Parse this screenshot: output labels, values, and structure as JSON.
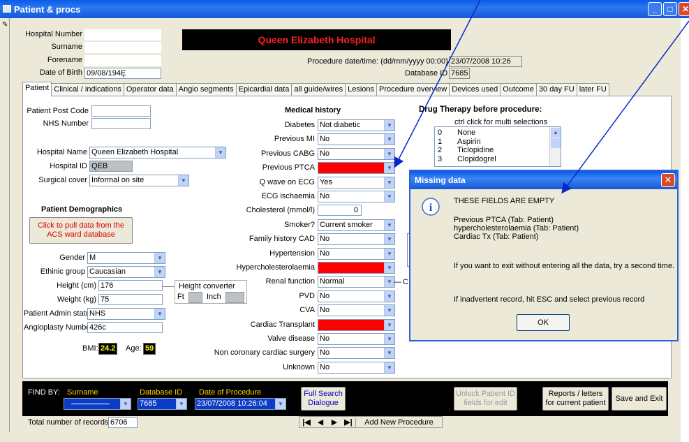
{
  "window": {
    "title": "Patient & procs"
  },
  "header": {
    "hospital_number_label": "Hospital Number",
    "surname_label": "Surname",
    "forename_label": "Forename",
    "dob_label": "Date of Birth",
    "dob_value": "09/08/194Ȩ",
    "hospital_banner": "Queen Elizabeth Hospital",
    "proc_date_label": "Procedure date/time: (dd/mm/yyyy 00:00)",
    "proc_date_value": "23/07/2008 10:26",
    "database_id_label": "Database ID",
    "database_id_value": "7685"
  },
  "tabs": [
    "Patient",
    "Clinical / indications",
    "Operator data",
    "Angio segments",
    "Epicardial data",
    "all guide/wires",
    "Lesions",
    "Procedure overview",
    "Devices used",
    "Outcome",
    "30 day FU",
    "later FU"
  ],
  "patient": {
    "post_code_label": "Patient Post Code",
    "nhs_label": "NHS Number",
    "hospital_name_label": "Hospital Name",
    "hospital_name_value": "Queen Elizabeth Hospital",
    "hospital_id_label": "Hospital ID",
    "hospital_id_value": "QEB",
    "surgical_cover_label": "Surgical cover",
    "surgical_cover_value": "Informal on site",
    "demographics_title": "Patient Demographics",
    "pull_button": "Click to pull data from the ACS ward database",
    "gender_label": "Gender",
    "gender_value": "M",
    "ethnic_label": "Ethinic group",
    "ethnic_value": "Caucasian",
    "height_label": "Height (cm)",
    "height_value": "176",
    "weight_label": "Weight (kg)",
    "weight_value": "75",
    "admin_label": "Patient Admin status",
    "admin_value": "NHS",
    "angio_label": "Angioplasty Number",
    "angio_value": "426c",
    "bmi_label": "BMI:",
    "bmi_value": "24.2",
    "age_label": "Age:",
    "age_value": "59",
    "height_conv_title": "Height converter",
    "ft_label": "Ft",
    "inch_label": "Inch"
  },
  "medical": {
    "title": "Medical history",
    "rows": [
      {
        "label": "Diabetes",
        "value": "Not diabetic",
        "red": false
      },
      {
        "label": "Previous MI",
        "value": "No",
        "red": false
      },
      {
        "label": "Previous CABG",
        "value": "No",
        "red": false
      },
      {
        "label": "Previous PTCA",
        "value": "",
        "red": true
      },
      {
        "label": "Q wave on ECG",
        "value": "Yes",
        "red": false
      },
      {
        "label": "ECG ischaemia",
        "value": "No",
        "red": false
      },
      {
        "label": "Cholesterol (mmol/l)",
        "value": "0",
        "red": false,
        "text": true
      },
      {
        "label": "Smoker?",
        "value": "Current smoker",
        "red": false
      },
      {
        "label": "Family history CAD",
        "value": "No",
        "red": false
      },
      {
        "label": "Hypertension",
        "value": "No",
        "red": false
      },
      {
        "label": "Hypercholesterolaemia",
        "value": "",
        "red": true
      },
      {
        "label": "Renal function",
        "value": "Normal",
        "red": false
      },
      {
        "label": "PVD",
        "value": "No",
        "red": false
      },
      {
        "label": "CVA",
        "value": "No",
        "red": false
      },
      {
        "label": "Cardiac Transplant",
        "value": "",
        "red": true
      },
      {
        "label": "Valve disease",
        "value": "No",
        "red": false
      },
      {
        "label": "Non coronary cardiac surgery",
        "value": "No",
        "red": false
      },
      {
        "label": "Unknown",
        "value": "No",
        "red": false
      }
    ]
  },
  "drug": {
    "title": "Drug Therapy before procedure:",
    "hint": "ctrl click for multi selections",
    "items": [
      {
        "n": "0",
        "name": "None"
      },
      {
        "n": "1",
        "name": "Aspirin"
      },
      {
        "n": "2",
        "name": "Ticlopidine"
      },
      {
        "n": "3",
        "name": "Clopidogrel"
      }
    ]
  },
  "dialog": {
    "title": "Missing data",
    "heading": "THESE FIELDS ARE EMPTY",
    "line1": "Previous PTCA (Tab: Patient)",
    "line2": "hypercholesterolaemia (Tab: Patient)",
    "line3": "Cardiac Tx (Tab: Patient)",
    "msg1": "If you want to exit without entering all the data, try a second time.",
    "msg2": "If inadvertent record, hit ESC and select previous record",
    "ok": "OK"
  },
  "findbar": {
    "find_by": "FIND BY:",
    "surname": "Surname",
    "dbid_label": "Database ID",
    "dbid_value": "7685",
    "date_label": "Date of Procedure",
    "date_value": "23/07/2008 10:26:04",
    "full_search": "Full Search Dialogue",
    "unlock": "Unlock Patient ID fields for edit",
    "reports": "Reports / letters for current patient",
    "save_exit": "Save and Exit"
  },
  "footer": {
    "total_label": "Total number of records",
    "total_value": "6706",
    "add_new": "Add New Procedure"
  },
  "colors": {
    "title_blue": "#0a5ae8",
    "missing_red": "#ff0000",
    "arrow_blue": "#0a28c8"
  }
}
